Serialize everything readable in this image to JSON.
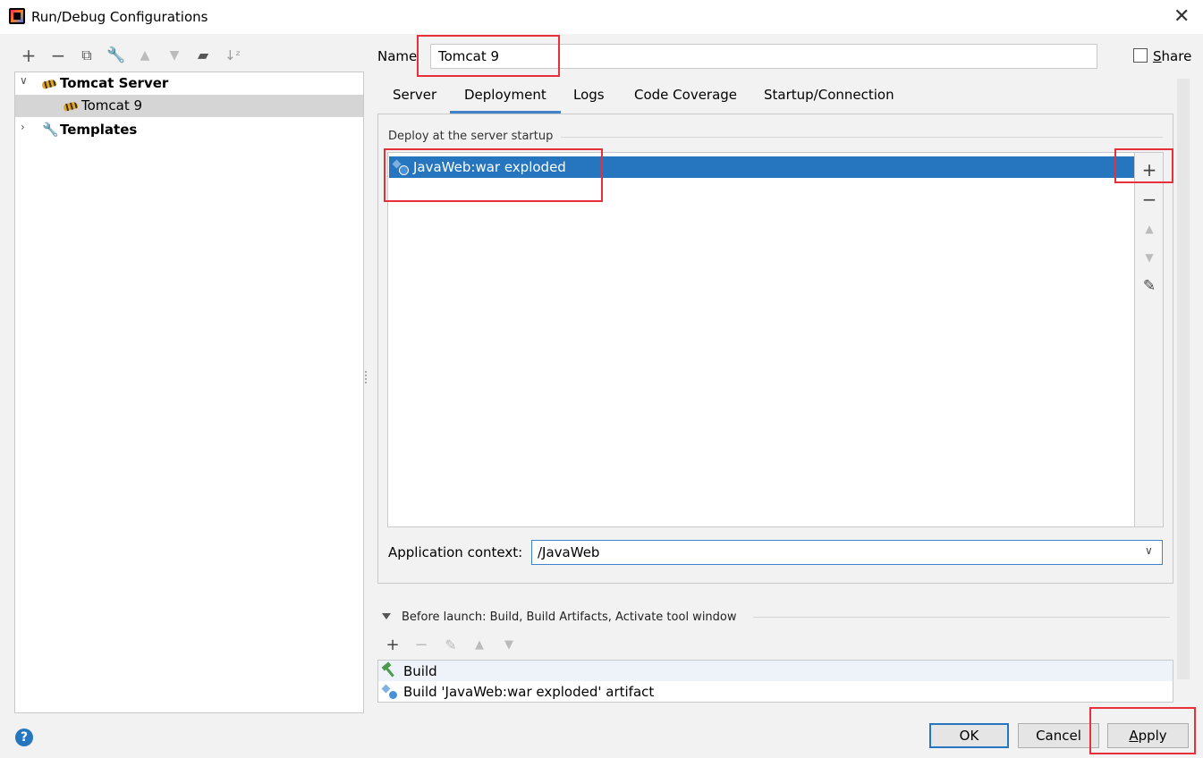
{
  "window": {
    "title": "Run/Debug Configurations",
    "close_icon": "close-icon"
  },
  "toolbar": {
    "icons": [
      "add-icon",
      "remove-icon",
      "copy-icon",
      "wrench-icon",
      "move-up-icon",
      "move-down-icon",
      "new-folder-icon",
      "sort-icon"
    ]
  },
  "tree": {
    "group_label": "Tomcat Server",
    "child_label": "Tomcat 9",
    "templates_label": "Templates"
  },
  "name_field": {
    "label": "Name",
    "value": "Tomcat 9"
  },
  "share": {
    "label": "Share",
    "checked": false
  },
  "tabs": [
    "Server",
    "Deployment",
    "Logs",
    "Code Coverage",
    "Startup/Connection"
  ],
  "active_tab": "Deployment",
  "deployment": {
    "section_title": "Deploy at the server startup",
    "items": [
      "JavaWeb:war exploded"
    ],
    "side_actions": [
      "add-icon",
      "remove-icon",
      "move-up-icon",
      "move-down-icon",
      "edit-icon"
    ]
  },
  "app_context": {
    "label": "Application context:",
    "value": "/JavaWeb"
  },
  "before_launch": {
    "title": "Before launch: Build, Build Artifacts, Activate tool window",
    "actions": [
      "add-icon",
      "remove-icon",
      "edit-icon",
      "move-up-icon",
      "move-down-icon"
    ],
    "items": [
      "Build",
      "Build 'JavaWeb:war exploded' artifact"
    ]
  },
  "buttons": {
    "ok": "OK",
    "cancel": "Cancel",
    "apply": "Apply"
  },
  "help_icon": "help-icon",
  "colors": {
    "selection": "#2675bf",
    "highlight_box": "#e8303a",
    "active_tab": "#4083c9"
  }
}
